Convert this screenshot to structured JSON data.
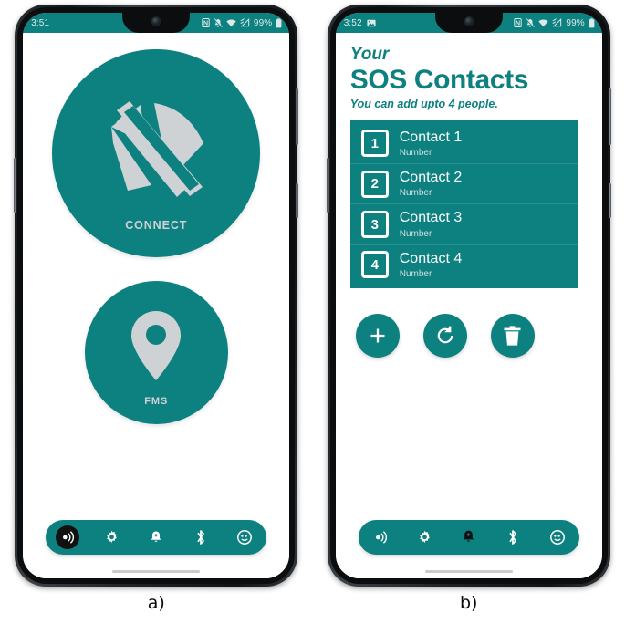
{
  "figure": {
    "panels": [
      {
        "caption": "a)"
      },
      {
        "caption": "b)"
      }
    ]
  },
  "colors": {
    "teal": "#0d8080",
    "icon_gray": "#cfd2d4",
    "white": "#ffffff",
    "frame_dark": "#15181b"
  },
  "phone_a": {
    "status_bar": {
      "time": "3:51",
      "battery_percent": "99%",
      "icons": [
        "nfc-icon",
        "notifications-off-icon",
        "wifi-icon",
        "mobile-data-icon",
        "battery-icon"
      ]
    },
    "connect_button": {
      "label": "CONNECT",
      "icon": "wifi-off-icon"
    },
    "fms_button": {
      "label": "FMS",
      "icon": "location-pin-icon"
    },
    "bottom_nav": {
      "items": [
        {
          "name": "broadcast",
          "icon": "broadcast-signal-icon",
          "active": true
        },
        {
          "name": "settings",
          "icon": "gear-icon",
          "active": false
        },
        {
          "name": "alerts",
          "icon": "bell-plus-icon",
          "active": false
        },
        {
          "name": "bluetooth",
          "icon": "bluetooth-icon",
          "active": false
        },
        {
          "name": "profile",
          "icon": "face-profile-icon",
          "active": false
        }
      ]
    }
  },
  "phone_b": {
    "status_bar": {
      "time": "3:52",
      "battery_percent": "99%",
      "icons": [
        "gallery-icon",
        "nfc-icon",
        "notifications-off-icon",
        "wifi-icon",
        "mobile-data-icon",
        "battery-icon"
      ]
    },
    "header": {
      "pre_title": "Your",
      "title": "SOS Contacts",
      "subtitle": "You can add upto 4 people."
    },
    "contacts": [
      {
        "number": "1",
        "name": "Contact 1",
        "sub": "Number"
      },
      {
        "number": "2",
        "name": "Contact 2",
        "sub": "Number"
      },
      {
        "number": "3",
        "name": "Contact 3",
        "sub": "Number"
      },
      {
        "number": "4",
        "name": "Contact 4",
        "sub": "Number"
      }
    ],
    "actions": [
      {
        "name": "add",
        "icon": "plus-icon"
      },
      {
        "name": "refresh",
        "icon": "refresh-icon"
      },
      {
        "name": "delete",
        "icon": "trash-icon"
      }
    ],
    "bottom_nav": {
      "items": [
        {
          "name": "broadcast",
          "icon": "broadcast-signal-icon",
          "active": false
        },
        {
          "name": "settings",
          "icon": "gear-icon",
          "active": false
        },
        {
          "name": "alerts",
          "icon": "bell-plus-icon",
          "active": true
        },
        {
          "name": "bluetooth",
          "icon": "bluetooth-icon",
          "active": false
        },
        {
          "name": "profile",
          "icon": "face-profile-icon",
          "active": false
        }
      ]
    }
  }
}
